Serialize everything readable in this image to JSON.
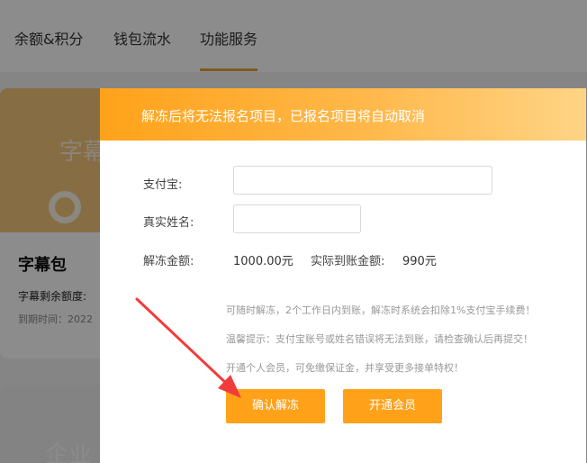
{
  "tabs": {
    "items": [
      {
        "label": "余额&积分"
      },
      {
        "label": "钱包流水"
      },
      {
        "label": "功能服务"
      }
    ],
    "active_index": 2
  },
  "card": {
    "banner_text": "字幕",
    "title": "字幕包",
    "line1": "字幕剩余额度:",
    "line2": "到期时间：2022"
  },
  "card2": {
    "banner_text": "企业"
  },
  "modal": {
    "title": "解冻后将无法报名项目，已报名项目将自动取消",
    "alipay_label": "支付宝:",
    "alipay_value": "",
    "name_label": "真实姓名:",
    "name_value": "",
    "amount_label": "解冻金额:",
    "amount_value": "1000.00元",
    "actual_label": "实际到账金额:",
    "actual_value": "990元",
    "tips": [
      "可随时解冻，2个工作日内到账，解冻时系统会扣除1%支付宝手续费！",
      "温馨提示：支付宝账号或姓名错误将无法到账，请检查确认后再提交！",
      "开通个人会员，可免缴保证金，并享受更多接单特权！"
    ],
    "confirm_button": "确认解冻",
    "member_button": "开通会员"
  },
  "colors": {
    "accent": "#ffa21a",
    "arrow": "#f23c3c"
  }
}
